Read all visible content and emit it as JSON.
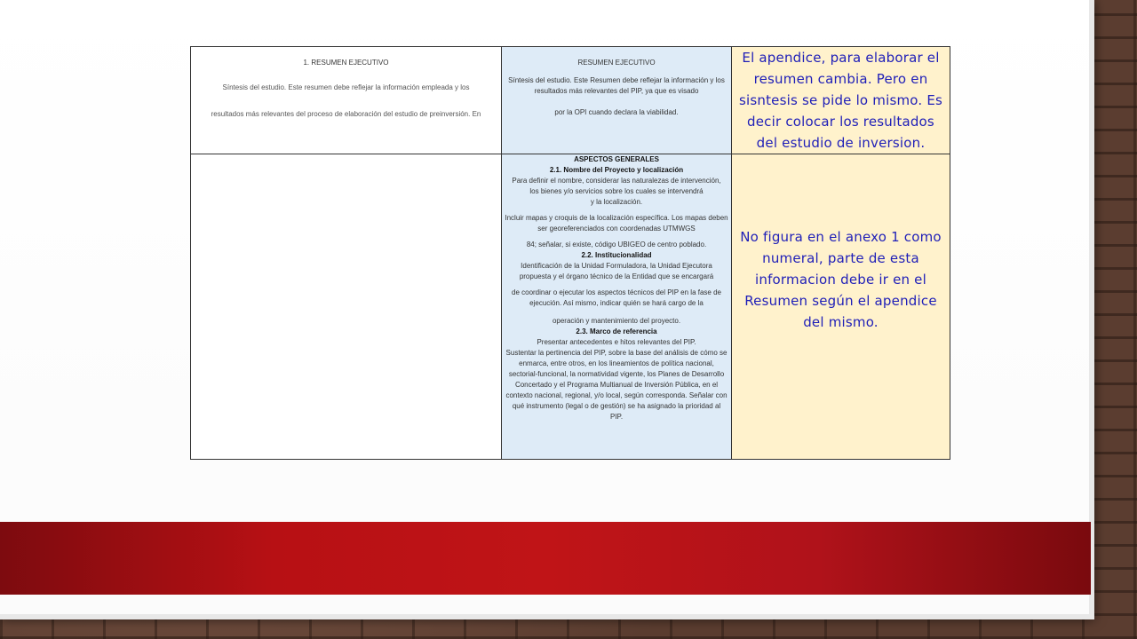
{
  "slide": {
    "colors": {
      "band": "#b71014",
      "col2_bg": "#deebf7",
      "col3_bg": "#fff2cc",
      "note_text": "#1f1fb8"
    }
  },
  "table": {
    "row1": {
      "col1": {
        "heading": "1. RESUMEN EJECUTIVO",
        "text1": "Síntesis del estudio. Este resumen debe reflejar la información empleada y los",
        "text2": "resultados más relevantes del proceso de elaboración del estudio de preinversión. En"
      },
      "col2": {
        "heading": "RESUMEN EJECUTIVO",
        "text1": "Síntesis del estudio. Este Resumen debe reflejar la información y los resultados más relevantes del PIP, ya que es visado",
        "text2": "por la OPI cuando declara la viabilidad."
      },
      "col3": {
        "note": "El apendice, para elaborar el resumen cambia. Pero en sisntesis se pide lo mismo. Es decir colocar los resultados del estudio de inversion."
      }
    },
    "row2": {
      "col2": {
        "heading": "ASPECTOS GENERALES",
        "s21_title": "2.1. Nombre del Proyecto y localización",
        "s21_p1": "Para definir el nombre, considerar las naturalezas de intervención, los bienes y/o servicios sobre los cuales se intervendrá",
        "s21_p2": "y la localización.",
        "s21_p3": "Incluir mapas y croquis de la localización específica. Los mapas deben ser georeferenciados con coordenadas UTMWGS",
        "s21_p4": "84; señalar, si existe, código UBIGEO de centro poblado.",
        "s22_title": "2.2. Institucionalidad",
        "s22_p1": "Identificación de la Unidad Formuladora, la Unidad Ejecutora propuesta y el órgano técnico de la Entidad que se encargará",
        "s22_p2": "de coordinar o ejecutar los aspectos técnicos del PIP en la fase de ejecución. Así mismo, indicar quién se hará cargo de la",
        "s22_p3": "operación y mantenimiento del proyecto.",
        "s23_title": "2.3. Marco de referencia",
        "s23_p1": "Presentar antecedentes e hitos relevantes del PIP.",
        "s23_p2": "Sustentar la pertinencia del PIP, sobre la base del análisis de cómo se enmarca, entre otros, en los lineamientos de política nacional, sectorial-funcional, la normatividad vigente, los Planes de Desarrollo Concertado y el Programa Multianual de Inversión Pública, en el contexto nacional, regional, y/o local, según corresponda. Señalar con qué instrumento (legal o de gestión) se ha asignado la prioridad al PIP."
      },
      "col3": {
        "note": "No figura en el anexo 1 como numeral, parte de esta informacion debe ir en el Resumen según el apendice del mismo."
      }
    }
  }
}
